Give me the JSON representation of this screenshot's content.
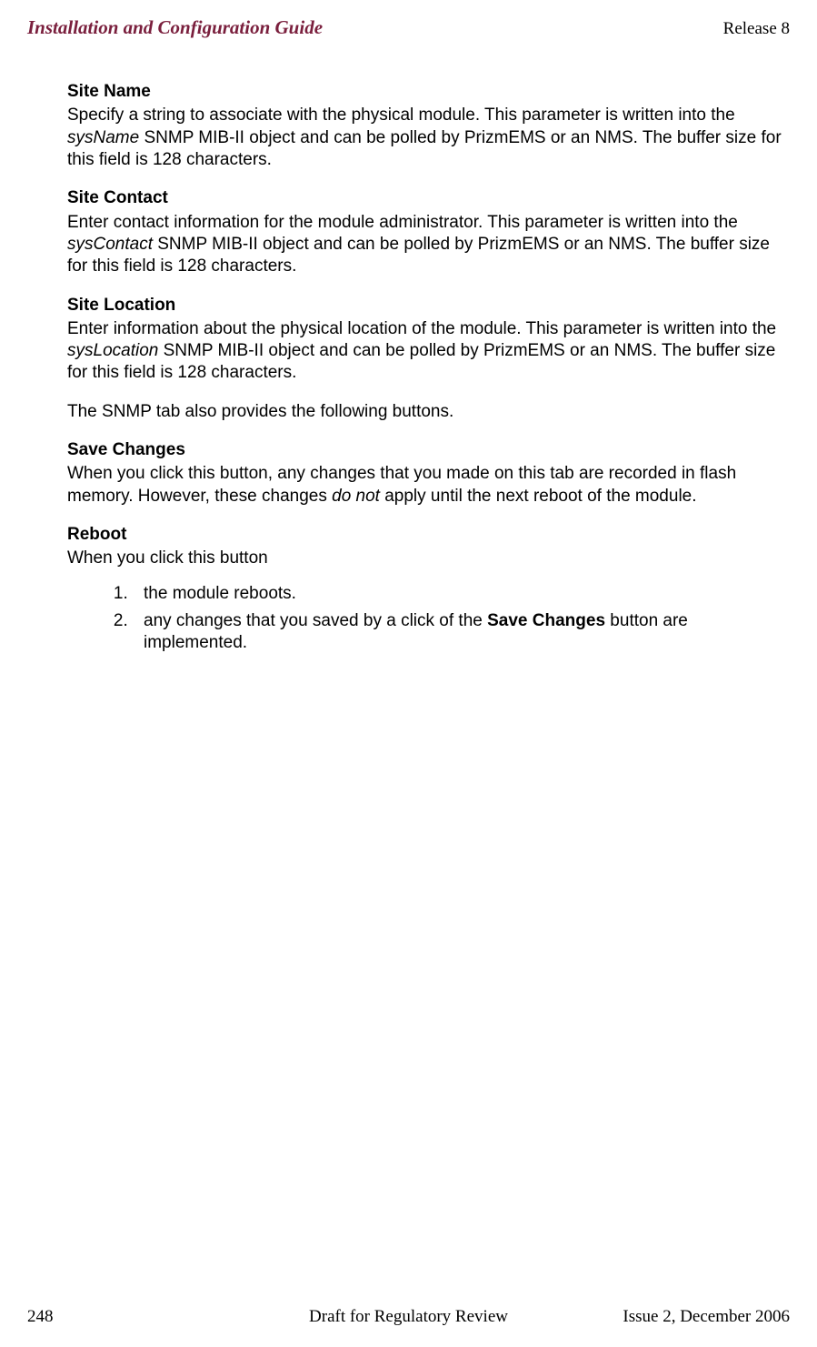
{
  "header": {
    "left": "Installation and Configuration Guide",
    "right": "Release 8"
  },
  "sections": {
    "siteName": {
      "heading": "Site Name",
      "body_prefix": "Specify a string to associate with the physical module. This parameter is written into the ",
      "body_italic": "sysName",
      "body_suffix": " SNMP MIB-II object and can be polled by PrizmEMS or an NMS. The buffer size for this field is 128 characters."
    },
    "siteContact": {
      "heading": "Site Contact",
      "body_prefix": "Enter contact information for the module administrator. This parameter is written into the ",
      "body_italic": "sysContact",
      "body_suffix": " SNMP MIB-II object and can be polled by PrizmEMS or an NMS. The buffer size for this field is 128 characters."
    },
    "siteLocation": {
      "heading": "Site Location",
      "body_prefix": "Enter information about the physical location of the module. This parameter is written into the ",
      "body_italic": "sysLocation",
      "body_suffix": " SNMP MIB-II object and can be polled by PrizmEMS or an NMS. The buffer size for this field is 128 characters."
    },
    "snmpNote": "The SNMP tab also provides the following buttons.",
    "saveChanges": {
      "heading": "Save Changes",
      "body_prefix": "When you click this button, any changes that you made on this tab are recorded in flash memory. However, these changes ",
      "body_italic": "do not",
      "body_suffix": " apply until the next reboot of the module."
    },
    "reboot": {
      "heading": "Reboot",
      "intro": "When you click this button",
      "items": {
        "one": "the module reboots.",
        "two_prefix": "any changes that you saved by a click of the ",
        "two_bold": "Save Changes",
        "two_suffix": " button are implemented."
      }
    }
  },
  "footer": {
    "pageNumber": "248",
    "center": "Draft for Regulatory Review",
    "right": "Issue 2, December 2006"
  }
}
